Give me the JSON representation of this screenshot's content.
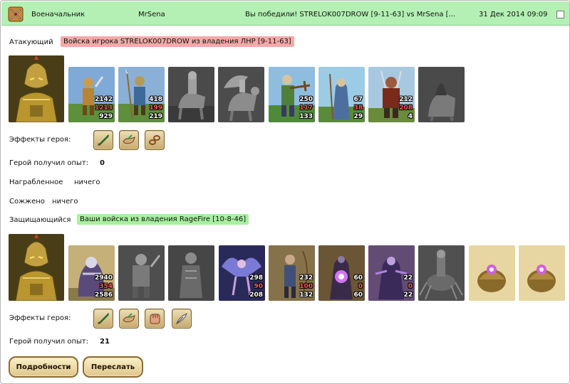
{
  "header": {
    "category": "Военачальник",
    "player": "MrSena",
    "title": "Вы победили! STRELOK007DROW [9-11-63] vs MrSena [...",
    "date": "31 Дек 2014 09:09",
    "icon": "battle-swords-icon"
  },
  "attacker": {
    "label": "Атакующий",
    "troops_title": "Войска игрока STRELOK007DROW из владения ЛНР [9-11-63]",
    "effects_label": "Эффекты героя:",
    "exp_label": "Герой получил опыт:",
    "exp_value": "0",
    "units": [
      {
        "name": "sword-soldier",
        "color": "#c99d4a",
        "gray": false,
        "total": "2142",
        "lost": "1213",
        "left": "929"
      },
      {
        "name": "spearman",
        "color": "#b59a55",
        "gray": false,
        "total": "418",
        "lost": "199",
        "left": "219"
      },
      {
        "name": "knight",
        "color": "#777777",
        "gray": true,
        "total": "",
        "lost": "",
        "left": ""
      },
      {
        "name": "pegasus-rider",
        "color": "#6e6e6e",
        "gray": true,
        "total": "",
        "lost": "",
        "left": ""
      },
      {
        "name": "crossbowman",
        "color": "#4f7f3f",
        "gray": false,
        "total": "250",
        "lost": "117",
        "left": "133"
      },
      {
        "name": "monk",
        "color": "#4d6f9d",
        "gray": false,
        "total": "67",
        "lost": "38",
        "left": "29"
      },
      {
        "name": "samurai",
        "color": "#9d5a3a",
        "gray": false,
        "total": "212",
        "lost": "208",
        "left": "4"
      },
      {
        "name": "dark-rider",
        "color": "#5a5a5a",
        "gray": true,
        "total": "",
        "lost": "",
        "left": ""
      }
    ],
    "effects": [
      "green-sword-icon",
      "shield-hands-icon",
      "link-chain-icon"
    ]
  },
  "looted": {
    "label": "Награбленное",
    "value": "ничего"
  },
  "burned": {
    "label": "Сожжено",
    "value": "ничего"
  },
  "defender": {
    "label": "Защищающийся",
    "troops_title": "Ваши войска из владения RageFire [10-8-46]",
    "effects_label": "Эффекты героя:",
    "exp_label": "Герой получил опыт:",
    "exp_value": "21",
    "units": [
      {
        "name": "armored-beast",
        "color": "#8f7d4e",
        "gray": false,
        "total": "2940",
        "lost": "354",
        "left": "2586"
      },
      {
        "name": "barbarian",
        "color": "#6a6a6a",
        "gray": true,
        "total": "",
        "lost": "",
        "left": ""
      },
      {
        "name": "warlord",
        "color": "#5e5e5e",
        "gray": true,
        "total": "",
        "lost": "",
        "left": ""
      },
      {
        "name": "harpy",
        "color": "#5a5aa6",
        "gray": false,
        "total": "298",
        "lost": "90",
        "left": "208"
      },
      {
        "name": "archer",
        "color": "#40507a",
        "gray": false,
        "total": "232",
        "lost": "100",
        "left": "132"
      },
      {
        "name": "magician",
        "color": "#3a2a4a",
        "gray": false,
        "total": "60",
        "lost": "0",
        "left": "60"
      },
      {
        "name": "dark-mage",
        "color": "#4a3a6a",
        "gray": false,
        "total": "22",
        "lost": "0",
        "left": "22"
      },
      {
        "name": "spider-rider",
        "color": "#585858",
        "gray": true,
        "total": "",
        "lost": "",
        "left": ""
      },
      {
        "name": "crystal-shell",
        "color": "#c7a055",
        "gray": false,
        "total": "",
        "lost": "",
        "left": ""
      },
      {
        "name": "crystal-shell",
        "color": "#c7a055",
        "gray": false,
        "total": "",
        "lost": "",
        "left": ""
      }
    ],
    "effects": [
      "green-sword-icon",
      "shield-hands-icon",
      "fist-icon",
      "feather-blade-icon"
    ]
  },
  "buttons": {
    "details": "Подробности",
    "forward": "Переслать"
  }
}
